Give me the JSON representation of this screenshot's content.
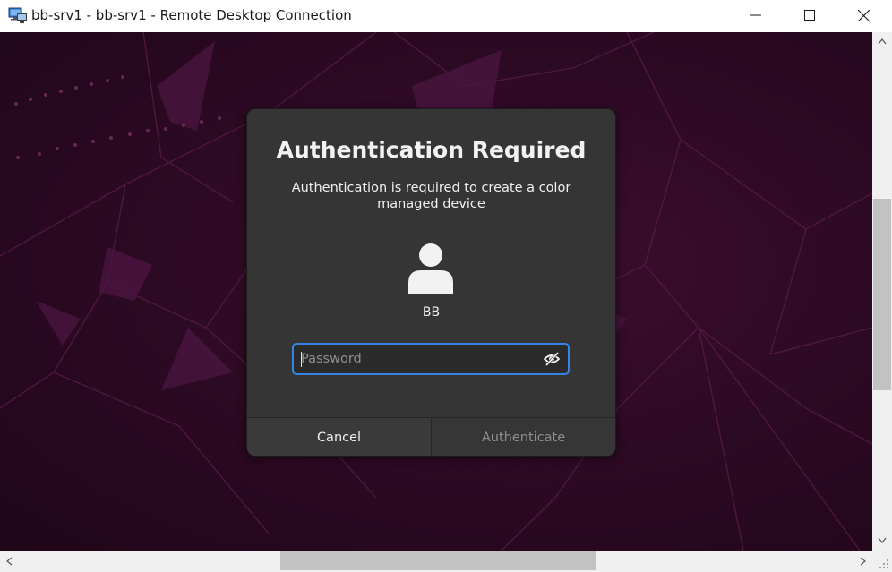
{
  "window": {
    "title": "bb-srv1 - bb-srv1 - Remote Desktop Connection",
    "app_icon": "remote-desktop-icon"
  },
  "dialog": {
    "title": "Authentication Required",
    "message": "Authentication is required to create a color managed device",
    "user_avatar_icon": "user-avatar-icon",
    "user_name": "BB",
    "password": {
      "placeholder": "Password",
      "value": "",
      "toggle_icon": "eye-slash-icon"
    },
    "cancel_label": "Cancel",
    "authenticate_label": "Authenticate"
  },
  "colors": {
    "accent": "#3584e4",
    "dialog_bg": "#353535",
    "desktop_bg": "#2e0a24"
  }
}
